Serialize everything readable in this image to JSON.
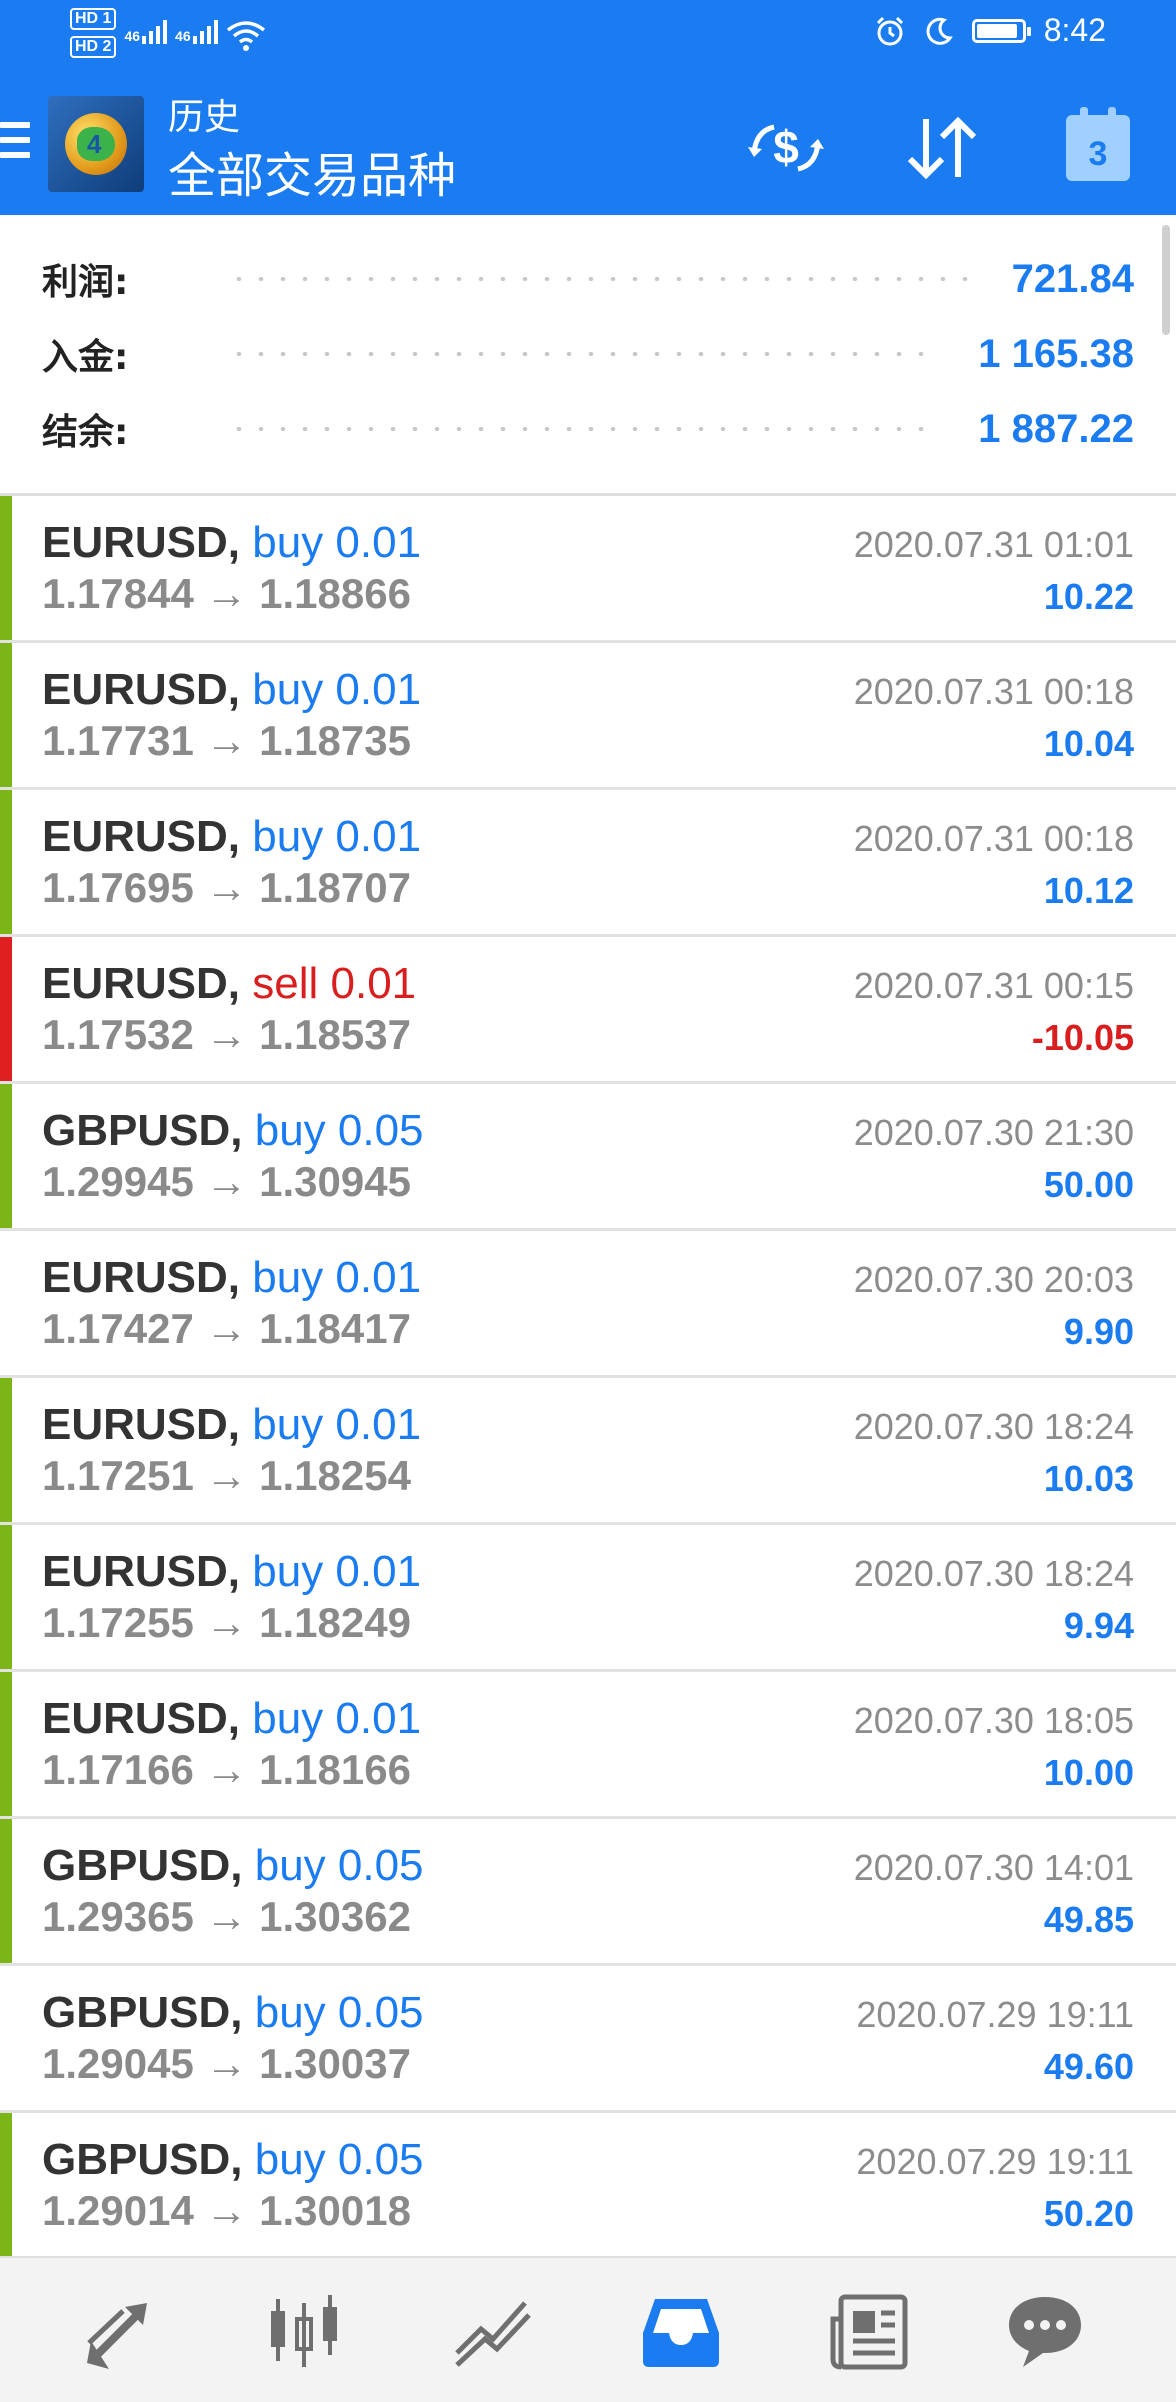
{
  "status_bar": {
    "hd1": "HD 1",
    "hd2": "HD 2",
    "net1": "46",
    "net2": "46",
    "time": "8:42"
  },
  "app_bar": {
    "title_small": "历史",
    "title_big": "全部交易品种",
    "calendar_day": "3"
  },
  "summary": {
    "profit_label": "利润:",
    "profit_value": "721.84",
    "deposit_label": "入金:",
    "deposit_value": "1 165.38",
    "balance_label": "结余:",
    "balance_value": "1 887.22"
  },
  "trades": [
    {
      "symbol": "EURUSD,",
      "side": "buy 0.01",
      "prices": "1.17844 → 1.18866",
      "time": "2020.07.31 01:01",
      "pnl": "10.22",
      "type": "buy"
    },
    {
      "symbol": "EURUSD,",
      "side": "buy 0.01",
      "prices": "1.17731 → 1.18735",
      "time": "2020.07.31 00:18",
      "pnl": "10.04",
      "type": "buy"
    },
    {
      "symbol": "EURUSD,",
      "side": "buy 0.01",
      "prices": "1.17695 → 1.18707",
      "time": "2020.07.31 00:18",
      "pnl": "10.12",
      "type": "buy"
    },
    {
      "symbol": "EURUSD,",
      "side": "sell 0.01",
      "prices": "1.17532 → 1.18537",
      "time": "2020.07.31 00:15",
      "pnl": "-10.05",
      "type": "sell"
    },
    {
      "symbol": "GBPUSD,",
      "side": "buy 0.05",
      "prices": "1.29945 → 1.30945",
      "time": "2020.07.30 21:30",
      "pnl": "50.00",
      "type": "buy"
    },
    {
      "symbol": "EURUSD,",
      "side": "buy 0.01",
      "prices": "1.17427 → 1.18417",
      "time": "2020.07.30 20:03",
      "pnl": "9.90",
      "type": "buy-nostripe"
    },
    {
      "symbol": "EURUSD,",
      "side": "buy 0.01",
      "prices": "1.17251 → 1.18254",
      "time": "2020.07.30 18:24",
      "pnl": "10.03",
      "type": "buy"
    },
    {
      "symbol": "EURUSD,",
      "side": "buy 0.01",
      "prices": "1.17255 → 1.18249",
      "time": "2020.07.30 18:24",
      "pnl": "9.94",
      "type": "buy"
    },
    {
      "symbol": "EURUSD,",
      "side": "buy 0.01",
      "prices": "1.17166 → 1.18166",
      "time": "2020.07.30 18:05",
      "pnl": "10.00",
      "type": "buy"
    },
    {
      "symbol": "GBPUSD,",
      "side": "buy 0.05",
      "prices": "1.29365 → 1.30362",
      "time": "2020.07.30 14:01",
      "pnl": "49.85",
      "type": "buy"
    },
    {
      "symbol": "GBPUSD,",
      "side": "buy 0.05",
      "prices": "1.29045 → 1.30037",
      "time": "2020.07.29 19:11",
      "pnl": "49.60",
      "type": "buy-nostripe"
    },
    {
      "symbol": "GBPUSD,",
      "side": "buy 0.05",
      "prices": "1.29014 → 1.30018",
      "time": "2020.07.29 19:11",
      "pnl": "50.20",
      "type": "buy"
    }
  ],
  "colors": {
    "accent": "#1a7cf0",
    "buy_stripe": "#7cb518",
    "sell_stripe": "#e02020",
    "sell_text": "#d81e1e"
  },
  "bottom_nav": [
    {
      "icon": "trade-arrows-icon"
    },
    {
      "icon": "candlestick-icon"
    },
    {
      "icon": "chart-lines-icon"
    },
    {
      "icon": "history-inbox-icon",
      "active": true
    },
    {
      "icon": "news-icon"
    },
    {
      "icon": "chat-icon"
    }
  ]
}
